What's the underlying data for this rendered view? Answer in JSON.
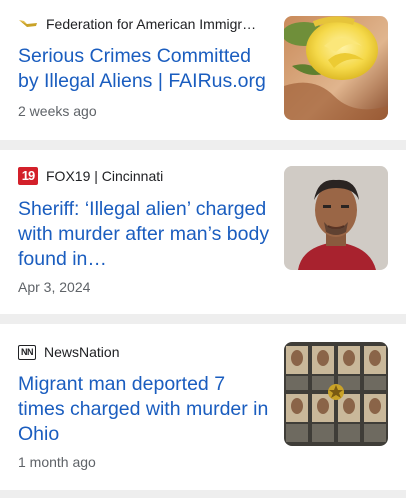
{
  "articles": [
    {
      "source": "Federation for American Immigr…",
      "source_icon": "fair-flag-icon",
      "headline": "Serious Crimes Committed by Illegal Aliens | FAIRus.org",
      "meta": "2 weeks ago",
      "thumbnail": "yellow-rose-photo"
    },
    {
      "source": "FOX19 | Cincinnati",
      "source_icon": "fox19-logo",
      "source_icon_text": "19",
      "headline": "Sheriff: ‘Illegal alien’ charged with murder after man’s body found in…",
      "meta": "Apr 3, 2024",
      "thumbnail": "mugshot-photo"
    },
    {
      "source": "NewsNation",
      "source_icon": "newsnation-logo",
      "source_icon_text": "NN",
      "headline": "Migrant man deported 7 times charged with murder in Ohio",
      "meta": "1 month ago",
      "thumbnail": "wanted-poster-grid-photo"
    }
  ],
  "colors": {
    "headline": "#1a5dbf",
    "source": "#202124",
    "meta": "#5f6368",
    "fox_red": "#d3202a",
    "divider": "#eeeeee"
  }
}
